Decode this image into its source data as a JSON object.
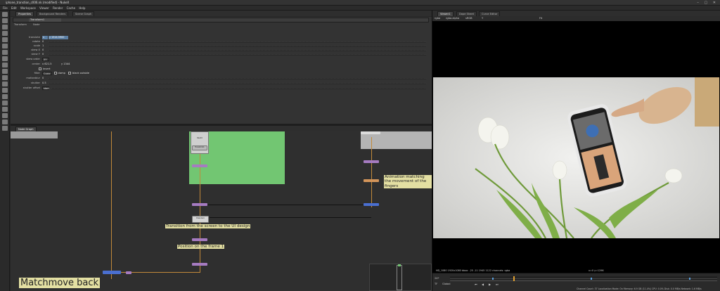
{
  "window": {
    "title": "iphone_transtion_c006.nk (modified) - NukeX",
    "controls": "– ▢ ✕"
  },
  "menu": [
    "File",
    "Edit",
    "Workspace",
    "Viewer",
    "Render",
    "Cache",
    "Help"
  ],
  "top_left_tabs": [
    "Properties",
    "Background Renders",
    "Scene Graph"
  ],
  "node_panel": {
    "node_name": "Transform1",
    "subtabs": [
      "Transform",
      "Node"
    ],
    "rows": [
      {
        "label": "translate",
        "value": "x"
      },
      {
        "label": "rotate",
        "value": "0"
      },
      {
        "label": "scale",
        "value": "1"
      },
      {
        "label": "skew X",
        "value": "0"
      },
      {
        "label": "skew Y",
        "value": "0"
      },
      {
        "label": "skew order",
        "value": "XY"
      },
      {
        "label": "center",
        "value": "x 621.5"
      },
      {
        "label": "filter",
        "value": "Cubic"
      },
      {
        "label": "",
        "value": ""
      },
      {
        "label": "motionblur",
        "value": "0"
      },
      {
        "label": "shutter",
        "value": "0.5"
      },
      {
        "label": "shutter offset",
        "value": "start"
      }
    ],
    "translate_y": "y 1514.5900",
    "center_y": "y 1344",
    "filter_extra": [
      "clamp",
      "black outside"
    ],
    "invert_label": "invert"
  },
  "node_graph": {
    "tab": "Node Graph",
    "notes": [
      "Transition from the screen to the UI design",
      "Position on the frame 1",
      "Animation matching the movement of the fingers",
      "Matchmove back"
    ],
    "nodes": [
      "Read4",
      "Transform1",
      "Dissolve1"
    ],
    "colors": {
      "backdrop_green": "#72c672",
      "backdrop_gray": "#b4b4b4",
      "pipe": "#c38a3a",
      "node_purple": "#a67bc1",
      "node_blue": "#4a6fd0",
      "node_orange": "#d4955a",
      "sticky": "#e3dfa2"
    }
  },
  "viewer": {
    "tabs": [
      "Viewer1",
      "Dope Sheet",
      "Curve Editor"
    ],
    "channels": "rgba",
    "layer": "rgba.alpha",
    "lut": "sRGB",
    "view": "Y",
    "zoom": "Fit",
    "info": "HD_1080 1920x1080  bbox: -25 -11 1945 1122 channels: rgba",
    "coords": "x=0 y=1296",
    "fps": "24*",
    "frame_mode": "TF",
    "frame_range_label": "Global",
    "status": "Channel Count: 37 Localization Mode: On Memory: 6.9 GB (11.4%) CPU: 0.0% Disk: 0.0 MB/s Network: 1.6 MB/s"
  }
}
